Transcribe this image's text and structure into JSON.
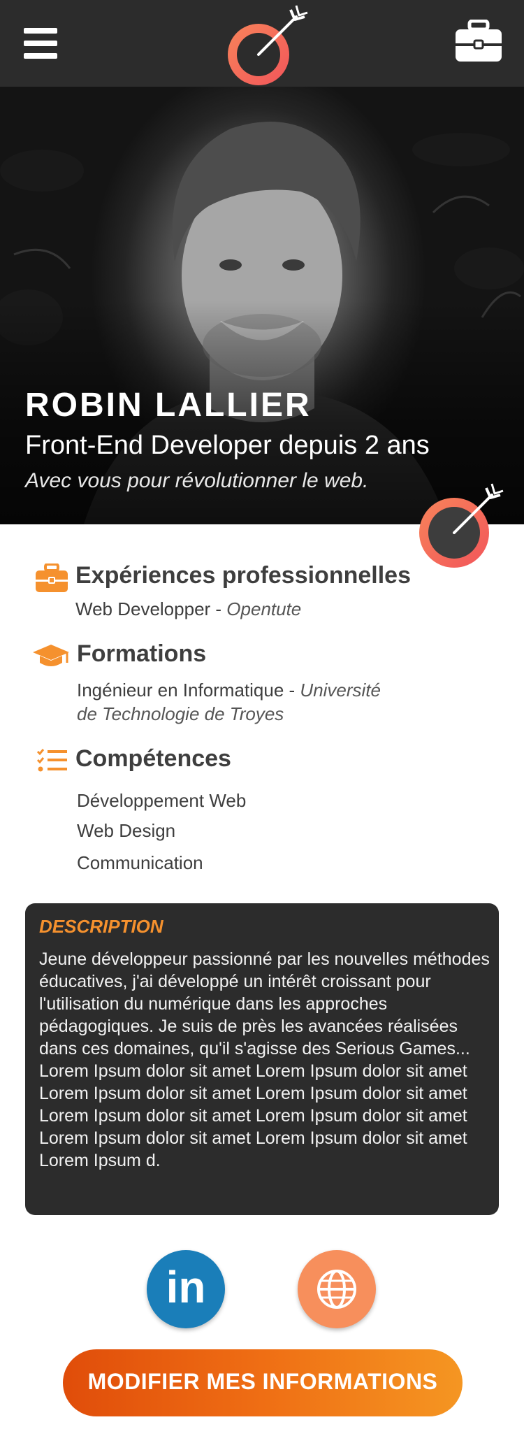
{
  "header": {
    "menu_icon": "hamburger-menu-icon",
    "logo_icon": "target-arrow-logo-icon",
    "briefcase_icon": "briefcase-icon"
  },
  "hero": {
    "name": "ROBIN LALLIER",
    "role": "Front-End Developer depuis 2 ans",
    "tagline": "Avec vous pour révolutionner le web."
  },
  "sections": {
    "experience": {
      "title": "Expériences professionnelles",
      "job": "Web Developper - ",
      "company": "Opentute"
    },
    "education": {
      "title": "Formations",
      "degree": "Ingénieur en Informatique - ",
      "school_line1": "Université",
      "school_line2": "de Technologie de Troyes"
    },
    "skills": {
      "title": "Compétences",
      "items": [
        "Développement Web",
        "Web Design",
        "Communication"
      ]
    }
  },
  "description": {
    "title": "DESCRIPTION",
    "text": "Jeune développeur passionné par les nouvelles méthodes éducatives, j'ai développé un intérêt croissant pour l'utilisation du numérique dans les approches pédagogiques. Je suis de près les avancées réalisées dans ces domaines, qu'il s'agisse des Serious Games... Lorem Ipsum dolor sit amet Lorem Ipsum dolor sit amet Lorem Ipsum dolor sit amet Lorem Ipsum dolor sit amet Lorem Ipsum dolor sit amet Lorem Ipsum dolor sit amet Lorem Ipsum dolor sit amet Lorem Ipsum dolor sit amet Lorem Ipsum d."
  },
  "social": {
    "linkedin_label": "in",
    "website_icon": "globe-icon"
  },
  "cta": {
    "label": "MODIFIER MES INFORMATIONS"
  },
  "colors": {
    "accent": "#f5912e",
    "dark": "#2c2c2c",
    "linkedin": "#1a7eb9",
    "logo_ring": "#f76a4f"
  }
}
